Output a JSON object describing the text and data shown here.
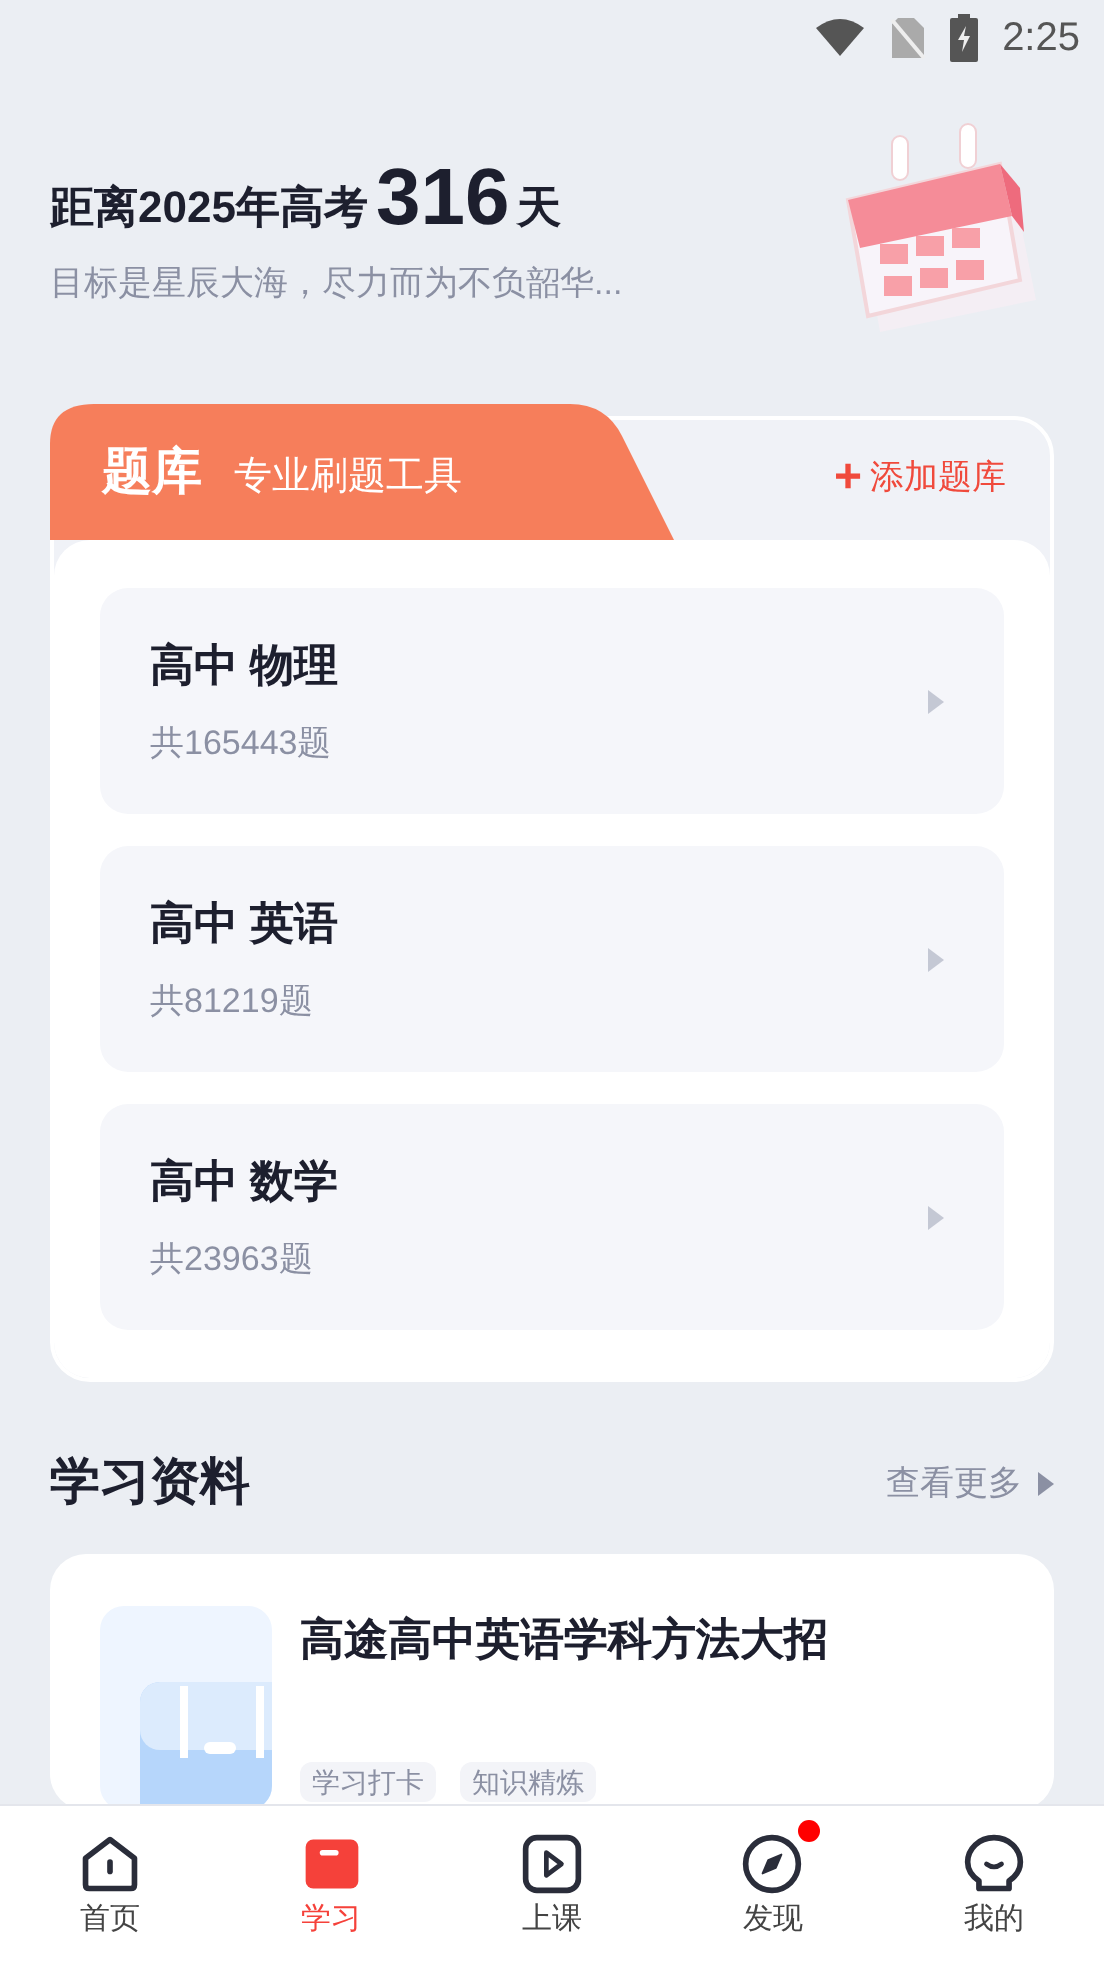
{
  "status_bar": {
    "time": "2:25"
  },
  "countdown": {
    "prefix": "距离2025年高考",
    "days": "316",
    "suffix": "天",
    "motto": "目标是星辰大海，尽力而为不负韶华..."
  },
  "question_bank": {
    "title": "题库",
    "subtitle": "专业刷题工具",
    "add_icon": "+",
    "add_label": "添加题库",
    "items": [
      {
        "name": "高中 物理",
        "count": "共165443题"
      },
      {
        "name": "高中 英语",
        "count": "共81219题"
      },
      {
        "name": "高中 数学",
        "count": "共23963题"
      }
    ]
  },
  "materials": {
    "title": "学习资料",
    "more": "查看更多",
    "items": [
      {
        "title": "高途高中英语学科方法大招",
        "tags": [
          "学习打卡",
          "知识精炼"
        ]
      }
    ]
  },
  "tab_bar": [
    {
      "kind": "home",
      "label": "首页",
      "selected": false,
      "badge": false
    },
    {
      "kind": "study",
      "label": "学习",
      "selected": true,
      "badge": false
    },
    {
      "kind": "class",
      "label": "上课",
      "selected": false,
      "badge": false
    },
    {
      "kind": "discover",
      "label": "发现",
      "selected": false,
      "badge": true
    },
    {
      "kind": "me",
      "label": "我的",
      "selected": false,
      "badge": false
    }
  ]
}
